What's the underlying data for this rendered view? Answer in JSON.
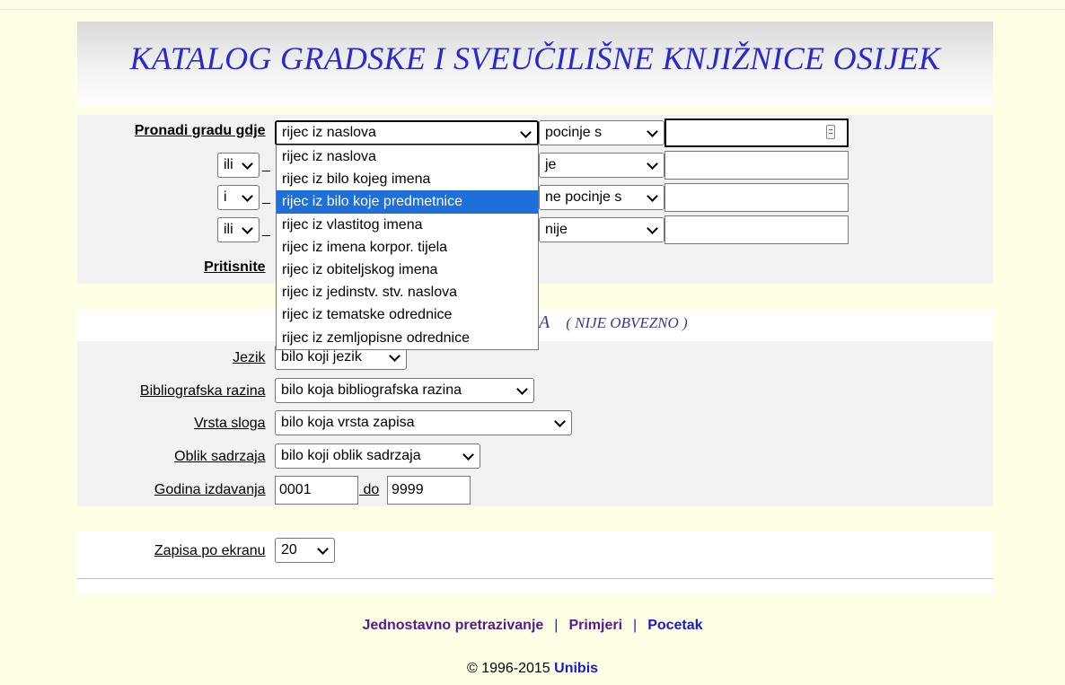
{
  "header": {
    "title": "KATALOG GRADSKE I SVEUČILIŠNE KNJIŽNICE OSIJEK"
  },
  "search": {
    "find_label": "Pronadi gradu gdje",
    "press_label": "Pritisnite",
    "rows": [
      {
        "field": "rijec iz naslova",
        "operator": "pocinje s",
        "term": ""
      },
      {
        "bool": "ili",
        "operator": "je",
        "term": ""
      },
      {
        "bool": "i",
        "operator": "ne pocinje s",
        "term": ""
      },
      {
        "bool": "ili",
        "operator": "nije",
        "term": ""
      }
    ],
    "field_options": [
      "rijec iz naslova",
      "rijec iz bilo kojeg imena",
      "rijec iz bilo koje predmetnice",
      "rijec iz vlastitog imena",
      "rijec iz imena korpor. tijela",
      "rijec iz obiteljskog imena",
      "rijec iz jedinstv. stv. naslova",
      "rijec iz tematske odrednice",
      "rijec iz zemljopisne odrednice"
    ],
    "highlighted_option": "rijec iz bilo koje predmetnice"
  },
  "limits": {
    "title_fragment": "A",
    "subtitle": "( NIJE OBVEZNO )",
    "language_label": "Jezik",
    "language_value": "bilo koji jezik",
    "biblevel_label": "Bibliografska razina",
    "biblevel_value": "bilo koja bibliografska razina",
    "rectype_label": "Vrsta sloga",
    "rectype_value": "bilo koja vrsta zapisa",
    "content_label": "Oblik sadrzaja",
    "content_value": "bilo koji oblik sadrzaja",
    "year_label": "Godina izdavanja",
    "year_from": "0001",
    "year_to_label": "do",
    "year_to": "9999"
  },
  "display": {
    "per_page_label": "Zapisa po ekranu",
    "per_page_value": "20"
  },
  "footer": {
    "link_simple": "Jednostavno pretrazivanje",
    "link_examples": "Primjeri",
    "link_home": "Pocetak",
    "sep": "|",
    "copyright": "© 1996-2015",
    "brand": "Unibis"
  },
  "colors": {
    "page_bg": "#FFFFE5",
    "title": "#2a2acc",
    "highlight": "#1e6fd9",
    "visited_link": "#551a8b",
    "link": "#1a1acc"
  }
}
